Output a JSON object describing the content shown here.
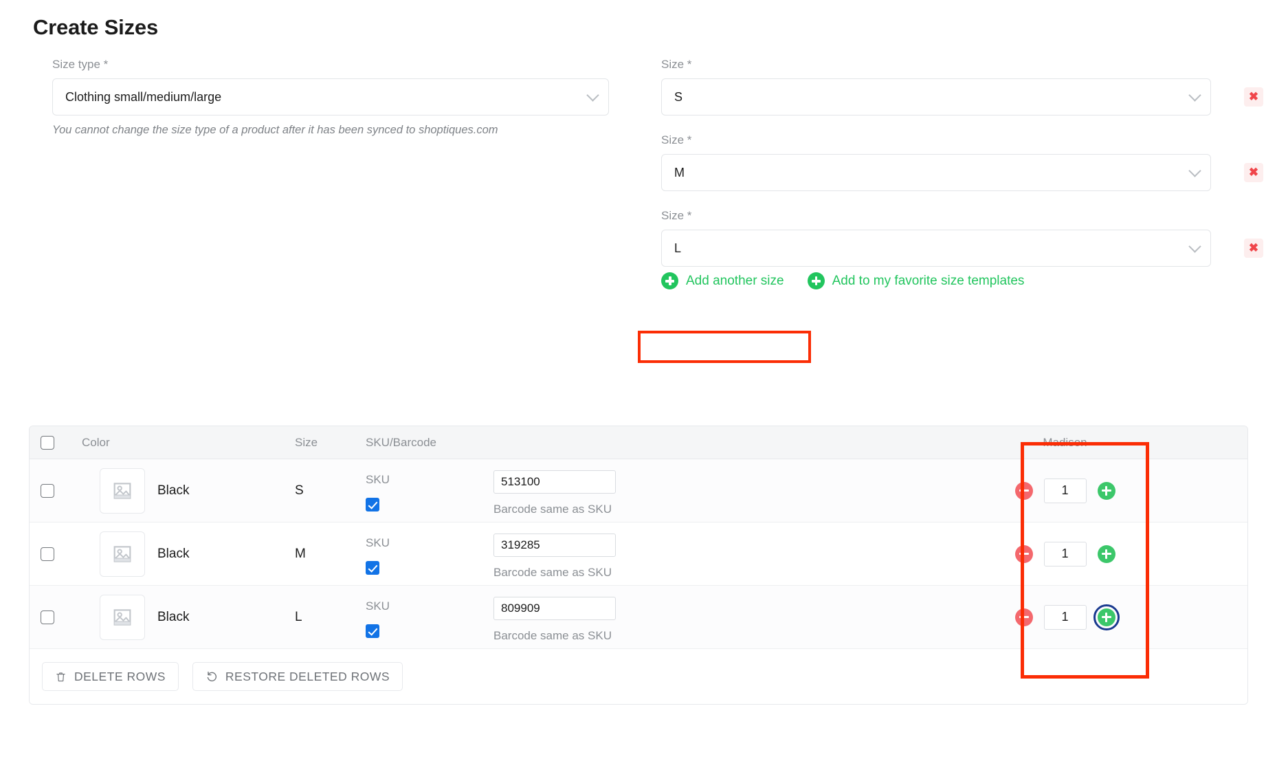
{
  "page": {
    "title": "Create Sizes"
  },
  "size_type": {
    "label": "Size type *",
    "value": "Clothing small/medium/large",
    "helper": "You cannot change the size type of a product after it has been synced to shoptiques.com",
    "chevron_icon": "chevron-down-icon"
  },
  "sizes": [
    {
      "label": "Size *",
      "value": "S",
      "remove_label": "✖"
    },
    {
      "label": "Size *",
      "value": "M",
      "remove_label": "✖"
    },
    {
      "label": "Size *",
      "value": "L",
      "remove_label": "✖"
    }
  ],
  "actions": {
    "add_another_size": "Add another size",
    "add_favorite_template": "Add to my favorite size templates",
    "plus_icon": "plus-circle-icon"
  },
  "table": {
    "headers": {
      "select_all": "",
      "color": "Color",
      "size": "Size",
      "sku_barcode": "SKU/Barcode",
      "blank": "",
      "location": "Madison"
    },
    "rows": [
      {
        "color": "Black",
        "size": "S",
        "sku_label": "SKU",
        "sku_value": "513100",
        "barcode_text": "Barcode same as SKU",
        "qty": "1",
        "thumb_icon": "image-placeholder-icon",
        "minus_icon": "minus-circle-icon",
        "plus_icon": "plus-circle-icon",
        "plus_focused": false
      },
      {
        "color": "Black",
        "size": "M",
        "sku_label": "SKU",
        "sku_value": "319285",
        "barcode_text": "Barcode same as SKU",
        "qty": "1",
        "thumb_icon": "image-placeholder-icon",
        "minus_icon": "minus-circle-icon",
        "plus_icon": "plus-circle-icon",
        "plus_focused": false
      },
      {
        "color": "Black",
        "size": "L",
        "sku_label": "SKU",
        "sku_value": "809909",
        "barcode_text": "Barcode same as SKU",
        "qty": "1",
        "thumb_icon": "image-placeholder-icon",
        "minus_icon": "minus-circle-icon",
        "plus_icon": "plus-circle-icon",
        "plus_focused": true
      }
    ],
    "footer": {
      "delete_rows": "DELETE ROWS",
      "restore_rows": "RESTORE DELETED ROWS",
      "trash_icon": "trash-icon",
      "restore_icon": "undo-arrow-icon"
    }
  },
  "colors": {
    "accent_green": "#22c55e",
    "danger_red": "#f0454a",
    "highlight_red": "#fb2d05",
    "checkbox_blue": "#1273e6",
    "focus_blue": "#1a3a8f",
    "minus_red": "#f4686d",
    "plus_green": "#3cc76a"
  },
  "annotations": {
    "highlight_add_size": "red-highlight-box",
    "highlight_quantity_column": "red-highlight-box"
  }
}
